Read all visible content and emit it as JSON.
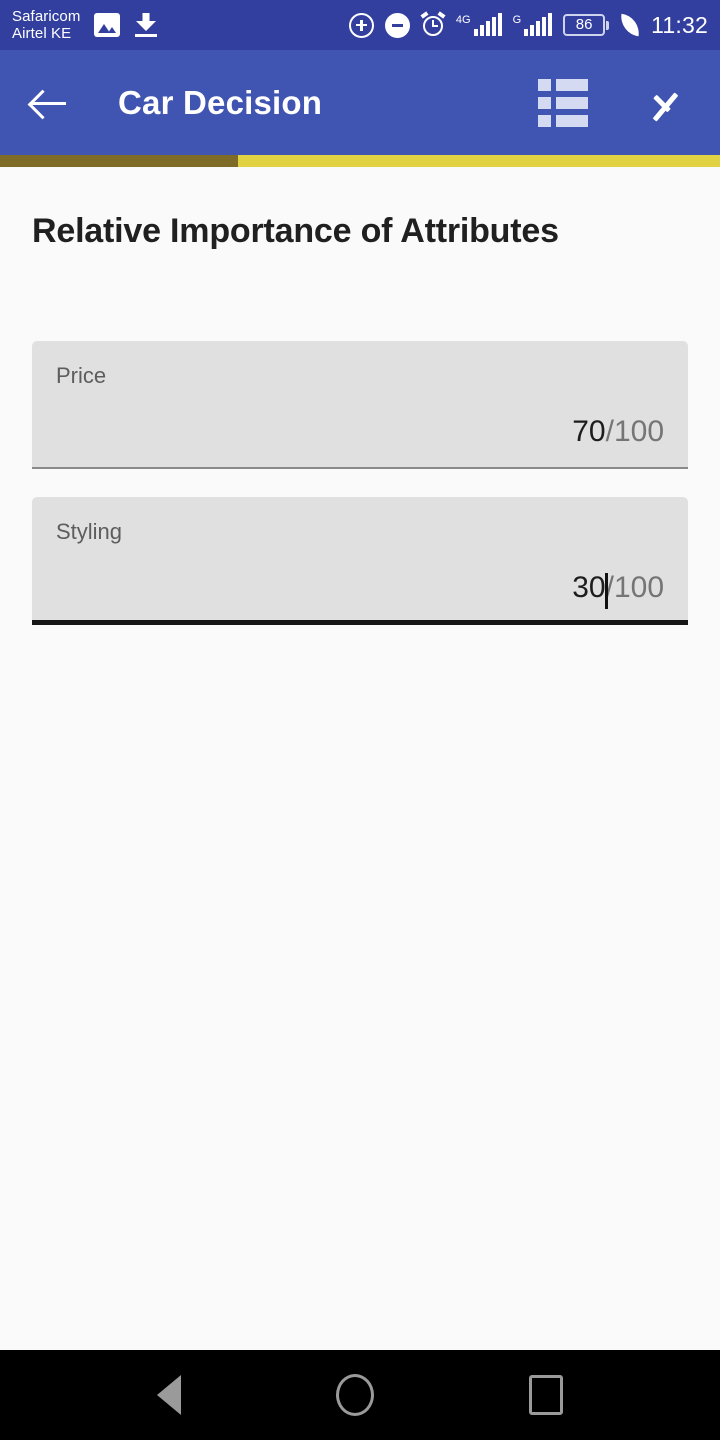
{
  "status_bar": {
    "carrier_line1": "Safaricom",
    "carrier_line2": "Airtel KE",
    "icons": [
      "image-icon",
      "download-icon",
      "add-circle-icon",
      "do-not-disturb-icon",
      "alarm-icon"
    ],
    "network_1_label": "4G",
    "network_2_label": "G",
    "battery_level": "86",
    "power_saving_icon": "leaf-icon",
    "time": "11:32",
    "background_color": "#333f9e"
  },
  "app_bar": {
    "back_label": "Back",
    "title": "Car Decision",
    "list_action_label": "View list",
    "confirm_action_label": "Done",
    "background_color": "#4054b2",
    "title_color": "#ffffff"
  },
  "progress": {
    "percent": 33,
    "fill_color": "#7e6b28",
    "track_color": "#e0d243"
  },
  "main": {
    "page_title": "Relative Importance of Attributes",
    "fields": [
      {
        "label": "Price",
        "value": "70",
        "counter": "/100",
        "focused": false,
        "max": 100
      },
      {
        "label": "Styling",
        "value": "30",
        "counter": "/100",
        "focused": true,
        "max": 100
      }
    ],
    "background_color": "#fafafa"
  },
  "nav_bar": {
    "back_label": "Back",
    "home_label": "Home",
    "recents_label": "Recents",
    "background_color": "#000000"
  }
}
